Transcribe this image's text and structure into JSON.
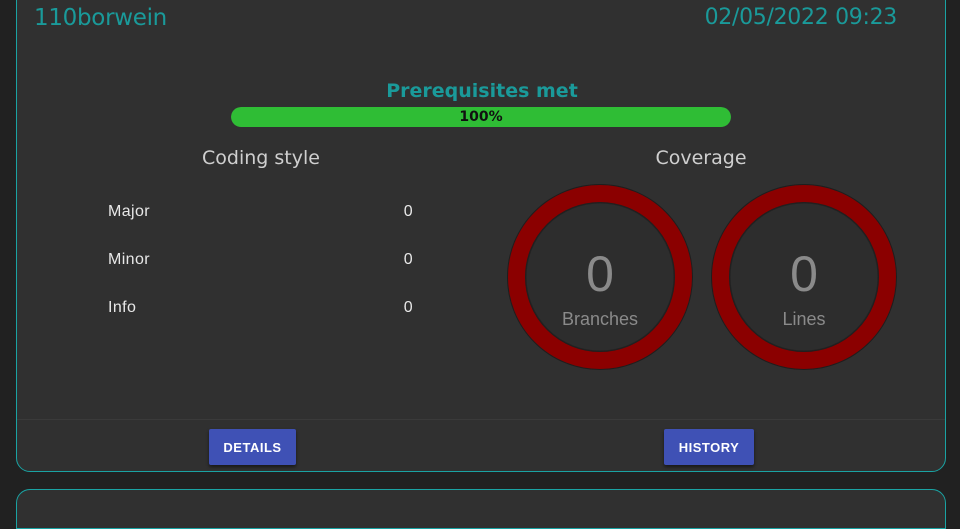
{
  "card": {
    "title": "110borwein",
    "date": "02/05/2022 09:23"
  },
  "prerequisites": {
    "label": "Prerequisites met",
    "percent_text": "100%",
    "value": 100,
    "color": "#2fbd35"
  },
  "coding_style": {
    "title": "Coding style",
    "metrics": [
      {
        "label": "Major",
        "value": "0"
      },
      {
        "label": "Minor",
        "value": "0"
      },
      {
        "label": "Info",
        "value": "0"
      }
    ]
  },
  "coverage": {
    "title": "Coverage",
    "gauges": [
      {
        "value": "0",
        "label": "Branches",
        "color": "#8b0000"
      },
      {
        "value": "0",
        "label": "Lines",
        "color": "#8b0000"
      }
    ]
  },
  "actions": {
    "details_label": "DETAILS",
    "history_label": "HISTORY",
    "button_color": "#3f51b5"
  },
  "colors": {
    "accent": "#1a9a9a",
    "card_bg": "#303030",
    "gauge_fail": "#8b0000"
  }
}
